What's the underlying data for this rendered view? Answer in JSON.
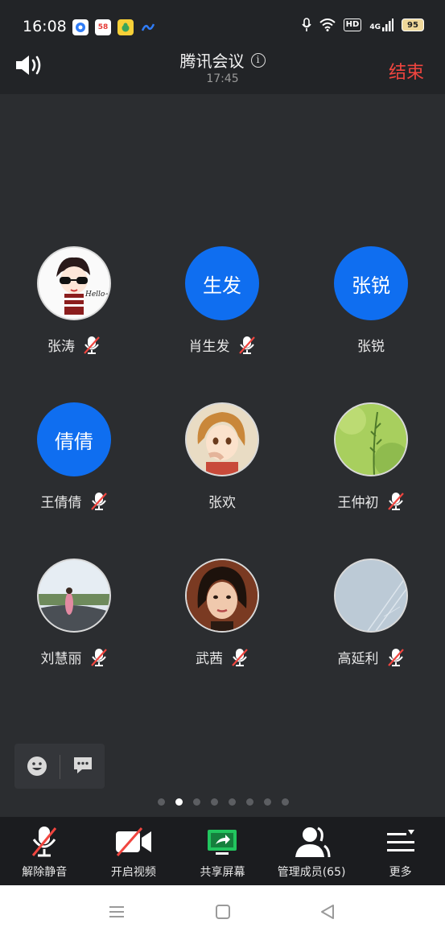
{
  "status_bar": {
    "time": "16:08",
    "app_badge_58": "58",
    "network": "4G",
    "hd": "HD",
    "battery": "95"
  },
  "header": {
    "title": "腾讯会议",
    "time": "17:45",
    "end_label": "结束"
  },
  "participants": [
    {
      "name": "张涛",
      "avatar_text": "",
      "muted": true
    },
    {
      "name": "肖生发",
      "avatar_text": "生发",
      "muted": true
    },
    {
      "name": "张锐",
      "avatar_text": "张锐",
      "muted": false
    },
    {
      "name": "王倩倩",
      "avatar_text": "倩倩",
      "muted": true
    },
    {
      "name": "张欢",
      "avatar_text": "",
      "muted": false
    },
    {
      "name": "王仲初",
      "avatar_text": "",
      "muted": true
    },
    {
      "name": "刘慧丽",
      "avatar_text": "",
      "muted": true
    },
    {
      "name": "武茜",
      "avatar_text": "",
      "muted": true
    },
    {
      "name": "高延利",
      "avatar_text": "",
      "muted": true
    }
  ],
  "avatar1_scribble": "Hello~",
  "pagination": {
    "total": 8,
    "current": 2
  },
  "toolbar": {
    "unmute": "解除静音",
    "video": "开启视频",
    "share": "共享屏幕",
    "members": "管理成员(65)",
    "more": "更多"
  },
  "colors": {
    "accent": "#0f6ef0",
    "end_red": "#f0453f",
    "share_green": "#22c55e"
  }
}
